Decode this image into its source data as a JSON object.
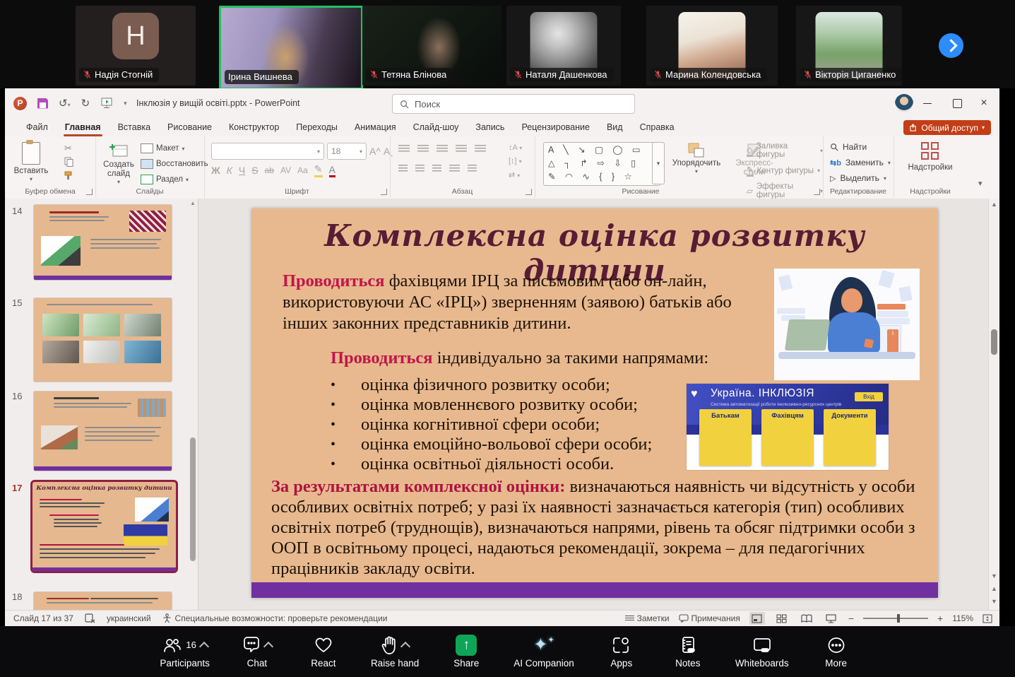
{
  "meeting": {
    "participants": [
      {
        "name": "Надія Стогній",
        "initial": "H",
        "muted": true
      },
      {
        "name": "Ірина Вишнева",
        "muted": false,
        "active_speaker": true
      },
      {
        "name": "Тетяна Блінова",
        "muted": true
      },
      {
        "name": "Наталя Дашенкова",
        "muted": true
      },
      {
        "name": "Марина Колендовська",
        "muted": true
      },
      {
        "name": "Вікторія Циганенко",
        "muted": true
      }
    ],
    "toolbar": [
      {
        "label": "Participants",
        "count": "16",
        "chevron": true
      },
      {
        "label": "Chat",
        "chevron": true
      },
      {
        "label": "React"
      },
      {
        "label": "Raise hand",
        "chevron": true
      },
      {
        "label": "Share"
      },
      {
        "label": "AI Companion"
      },
      {
        "label": "Apps"
      },
      {
        "label": "Notes"
      },
      {
        "label": "Whiteboards"
      },
      {
        "label": "More"
      }
    ],
    "colors": {
      "share_green": "#0ea558",
      "next_blue": "#2d8cff"
    }
  },
  "pp": {
    "titlebar": {
      "title": "Інклюзія у вищій освіті.pptx  -  PowerPoint",
      "search": "Поиск",
      "logo_letter": "P"
    },
    "tabs": [
      "Файл",
      "Главная",
      "Вставка",
      "Рисование",
      "Конструктор",
      "Переходы",
      "Анимация",
      "Слайд-шоу",
      "Запись",
      "Рецензирование",
      "Вид",
      "Справка"
    ],
    "active_tab": "Главная",
    "share": "Общий доступ",
    "ribbon": {
      "clipboard": {
        "paste": "Вставить",
        "group": "Буфер обмена"
      },
      "slides": {
        "new_slide": "Создать слайд",
        "layout": "Макет",
        "reset": "Восстановить",
        "section": "Раздел",
        "group": "Слайды"
      },
      "font": {
        "size": "18",
        "bold": "Ж",
        "italic": "К",
        "underline": "Ч",
        "strike": "S",
        "strike2": "ab",
        "spacing": "AV",
        "case": "Aa",
        "color": "А",
        "group": "Шрифт"
      },
      "paragraph": {
        "group": "Абзац"
      },
      "drawing": {
        "shapes_row1": "A ╲ ↘ ▢ ◯ ▭",
        "shapes_row2": "△ ┐ ↱ ⇨ ⇩ ▯",
        "shapes_row3": "✎ ◠ ∿ { } ☆",
        "arrange": "Упорядочить",
        "styles1": "Экспресс-",
        "styles2": "стили",
        "group": "Рисование"
      },
      "shape_format": {
        "fill": "Заливка фигуры",
        "outline": "Контур фигуры",
        "effects": "Эффекты фигуры"
      },
      "editing": {
        "find": "Найти",
        "replace": "Заменить",
        "select": "Выделить",
        "group": "Редактирование"
      },
      "addins": {
        "label": "Надстройки",
        "group": "Надстройки"
      }
    },
    "thumbnails": {
      "numbers": [
        "14",
        "15",
        "16",
        "17",
        "18"
      ],
      "current": "17"
    },
    "statusbar": {
      "slide": "Слайд 17 из 37",
      "language": "украинский",
      "accessibility": "Специальные возможности: проверьте рекомендации",
      "notes": "Заметки",
      "comments": "Примечания",
      "zoom": "115%"
    },
    "slide": {
      "title": "Комплексна оцінка розвитку дитини",
      "p1_lead": "Проводиться",
      "p1": " фахівцями ІРЦ за письмовим (або он-лайн, використовуючи АС «ІРЦ») зверненням (заявою) батьків або інших законних представників дитини.",
      "p2_lead": "Проводиться",
      "p2": " індивідуально за такими напрямами:",
      "bullets": [
        "оцінка фізичного розвитку особи;",
        "оцінка мовленнєвого розвитку особи;",
        "оцінка когнітивної сфери особи;",
        "оцінка емоційно-вольової сфери особи;",
        "оцінка освітньої діяльності особи."
      ],
      "p3_lead": "За результатами комплексної оцінки:",
      "p3": " визначаються наявність чи відсутність у особи особливих освітніх потреб; у разі їх наявності зазначається категорія (тип) особливих освітніх потреб (труднощів), визначаються напрями, рівень та обсяг підтримки особи з ООП в освітньому процесі, надаються рекомендації, зокрема – для педагогічних працівників закладу освіти.",
      "colors": {
        "background": "#e8b98f",
        "title": "#581c35",
        "lead": "#c0164a",
        "bottom_bar": "#7030a0"
      }
    },
    "inclusion_site": {
      "title": "Україна. ІНКЛЮЗІЯ",
      "subtitle": "Система автоматизації роботи інклюзивно-ресурсних центрів",
      "login": "Вхід",
      "cards": [
        "Батькам",
        "Фахівцям",
        "Документи"
      ],
      "colors": {
        "blue": "#303aa4",
        "yellow": "#f2d13f"
      }
    }
  },
  "glyphs": {
    "dropdown": "▾",
    "undo": "↺",
    "redo": "↻",
    "scissors": "✂",
    "close": "×",
    "bullet": "•",
    "more_dots": "•••",
    "share_arrow": "↑"
  }
}
